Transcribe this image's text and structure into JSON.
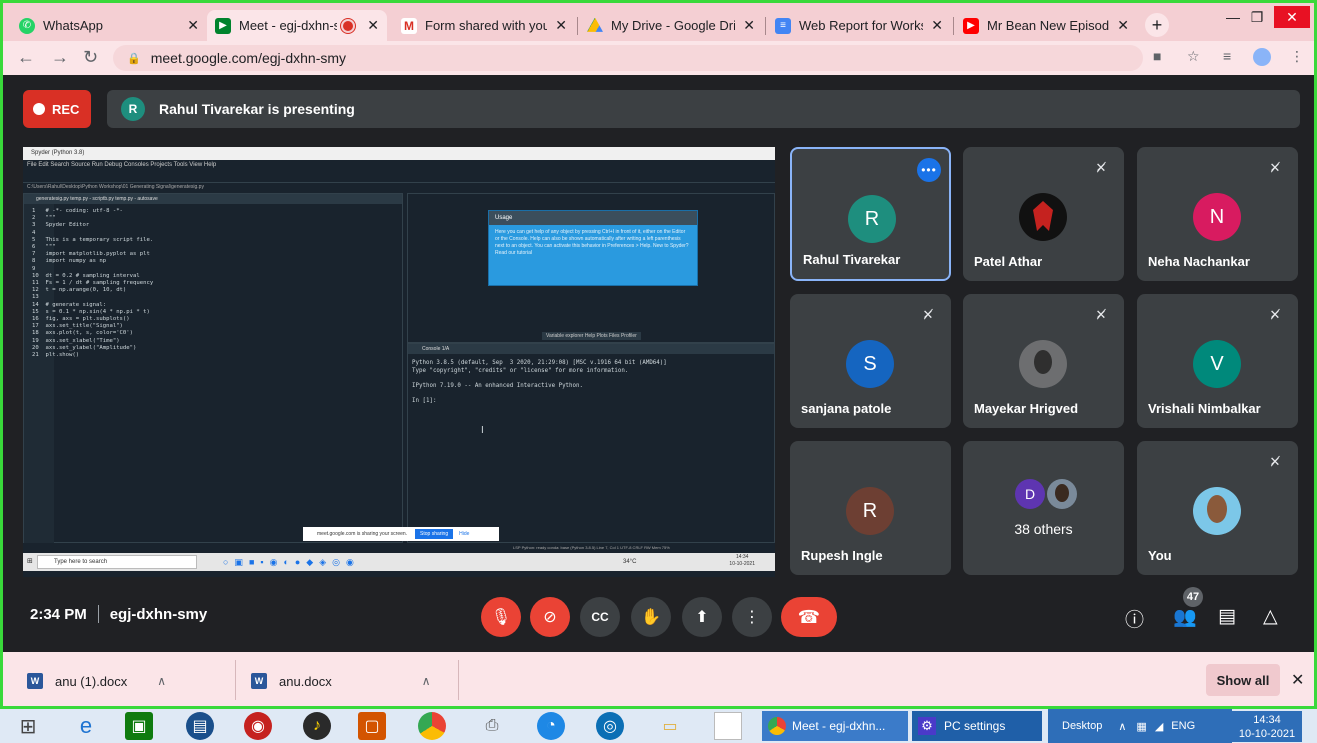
{
  "browser": {
    "tabs": [
      {
        "title": "WhatsApp",
        "active": false
      },
      {
        "title": "Meet - egj-dxhn-sm",
        "active": true
      },
      {
        "title": "Form shared with you:",
        "active": false
      },
      {
        "title": "My Drive - Google Drive",
        "active": false
      },
      {
        "title": "Web Report for Worksh",
        "active": false
      },
      {
        "title": "Mr Bean New Episodes |",
        "active": false
      }
    ],
    "new_tab_label": "+",
    "url": "meet.google.com/egj-dxhn-smy"
  },
  "meet": {
    "rec_label": "REC",
    "presenter_initial": "R",
    "presenting_text": "Rahul Tivarekar is presenting",
    "time": "2:34 PM",
    "meeting_code": "egj-dxhn-smy",
    "participant_count": "47",
    "tiles": [
      {
        "name": "Rahul Tivarekar",
        "initial": "R",
        "color": "#1e8e7e",
        "selected": true
      },
      {
        "name": "Patel Athar",
        "initial": "",
        "color": "#111111"
      },
      {
        "name": "Neha Nachankar",
        "initial": "N",
        "color": "#d81b60"
      },
      {
        "name": "sanjana patole",
        "initial": "S",
        "color": "#1565c0"
      },
      {
        "name": "Mayekar Hrigved",
        "initial": "",
        "color": "#6d6e70"
      },
      {
        "name": "Vrishali Nimbalkar",
        "initial": "V",
        "color": "#00897b"
      },
      {
        "name": "Rupesh Ingle",
        "initial": "R",
        "color": "#6d3f33"
      },
      {
        "name": "",
        "initial": "",
        "color": "#3c4043"
      },
      {
        "name": "You",
        "initial": "",
        "color": "#7cc7e8"
      }
    ],
    "others": {
      "initial": "D",
      "label": "38 others"
    }
  },
  "shared_screen": {
    "window_title": "Spyder (Python 3.8)",
    "menu": "File  Edit  Search  Source  Run  Debug  Consoles  Projects  Tools  View  Help",
    "path": "C:\\Users\\Rahul\\Desktop\\Python Workshop\\01 Generating Signal\\generatesig.py",
    "editor_tabs": "generatesig.py   temp.py - scriptb.py   temp.py - autosave",
    "code": "1   # -*- coding: utf-8 -*-\n2   \"\"\"\n3   Spyder Editor\n4\n5   This is a temporary script file.\n6   \"\"\"\n7   import matplotlib.pyplot as plt\n8   import numpy as np\n9\n10  dt = 0.2 # sampling interval\n11  Fs = 1 / dt # sampling frequency\n12  t = np.arange(0, 10, dt)\n13\n14  # generate signal:\n15  s = 0.1 * np.sin(4 * np.pi * t)\n16  fig, axs = plt.subplots()\n17  axs.set_title(\"Signal\")\n18  axs.plot(t, s, color='C0')\n19  axs.set_xlabel(\"Time\")\n20  axs.set_ylabel(\"Amplitude\")\n21  plt.show()",
    "usage_title": "Usage",
    "usage_text": "Here you can get help of any object by pressing Ctrl+I in front of it, either on the Editor or the Console. Help can also be shown automatically after writing a left parenthesis next to an object. You can activate this behavior in Preferences > Help. New to Spyder? Read our tutorial",
    "help_tabs": "Variable explorer  Help  Plots  Files  Profiler",
    "console_tab": "Console 1/A",
    "console_text": "Python 3.8.5 (default, Sep  3 2020, 21:29:08) [MSC v.1916 64 bit (AMD64)]\nType \"copyright\", \"credits\" or \"license\" for more information.\n\nIPython 7.19.0 -- An enhanced Interactive Python.\n\nIn [1]:",
    "share_notice": "meet.google.com is sharing your screen.",
    "stop_sharing": "Stop sharing",
    "hide": "Hide",
    "status": "LSP Python: ready   conda: base (Python 3.8.5)   Line 7, Col 1   UTF-8   CRLF   RW   Mem 75%",
    "taskbar_search": "Type here to search",
    "taskbar_time": "14:34",
    "taskbar_date": "10-10-2021",
    "weather": "34°C"
  },
  "downloads": {
    "items": [
      {
        "name": "anu (1).docx",
        "icon": "word-doc-icon"
      },
      {
        "name": "anu.docx",
        "icon": "word-doc-icon"
      }
    ],
    "show_all": "Show all"
  },
  "taskbar": {
    "windows": [
      {
        "label": "Meet - egj-dxhn...",
        "icon": "chrome-icon"
      },
      {
        "label": "PC settings",
        "icon": "gear-icon"
      }
    ],
    "desktop": "Desktop",
    "lang": "ENG",
    "time": "14:34",
    "date": "10-10-2021"
  },
  "colors": {
    "accent_green_border": "#39d93a",
    "meet_red": "#ea4335",
    "meet_bg": "#202124"
  }
}
